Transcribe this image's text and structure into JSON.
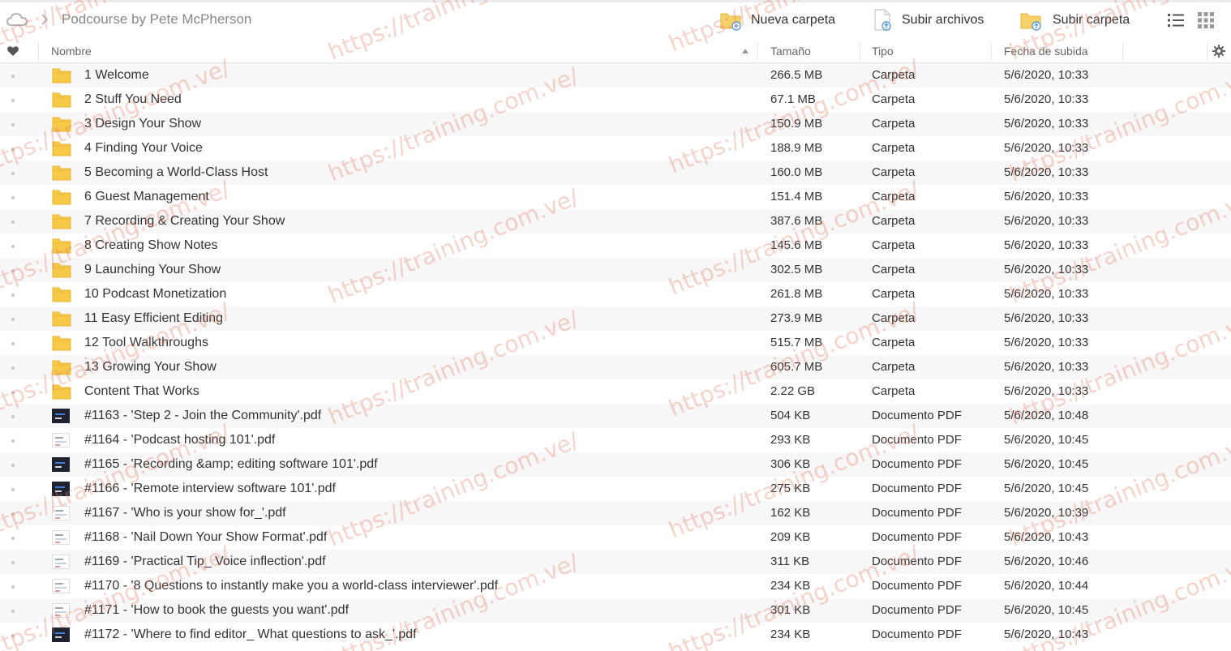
{
  "breadcrumb": {
    "title": "Podcourse by Pete McPherson"
  },
  "toolbar": {
    "new_folder": "Nueva carpeta",
    "upload_files": "Subir archivos",
    "upload_folder": "Subir carpeta"
  },
  "columns": {
    "name": "Nombre",
    "size": "Tamaño",
    "type": "Tipo",
    "date": "Fecha de subida"
  },
  "items": [
    {
      "kind": "folder",
      "name": "1 Welcome",
      "size": "266.5 MB",
      "type": "Carpeta",
      "date": "5/6/2020, 10:33"
    },
    {
      "kind": "folder",
      "name": "2 Stuff You Need",
      "size": "67.1 MB",
      "type": "Carpeta",
      "date": "5/6/2020, 10:33"
    },
    {
      "kind": "folder",
      "name": "3 Design Your Show",
      "size": "150.9 MB",
      "type": "Carpeta",
      "date": "5/6/2020, 10:33"
    },
    {
      "kind": "folder",
      "name": "4 Finding Your Voice",
      "size": "188.9 MB",
      "type": "Carpeta",
      "date": "5/6/2020, 10:33"
    },
    {
      "kind": "folder",
      "name": "5 Becoming a World-Class Host",
      "size": "160.0 MB",
      "type": "Carpeta",
      "date": "5/6/2020, 10:33"
    },
    {
      "kind": "folder",
      "name": "6 Guest Management",
      "size": "151.4 MB",
      "type": "Carpeta",
      "date": "5/6/2020, 10:33"
    },
    {
      "kind": "folder",
      "name": "7 Recording & Creating Your Show",
      "size": "387.6 MB",
      "type": "Carpeta",
      "date": "5/6/2020, 10:33"
    },
    {
      "kind": "folder",
      "name": "8 Creating Show Notes",
      "size": "145.6 MB",
      "type": "Carpeta",
      "date": "5/6/2020, 10:33"
    },
    {
      "kind": "folder",
      "name": "9 Launching Your Show",
      "size": "302.5 MB",
      "type": "Carpeta",
      "date": "5/6/2020, 10:33"
    },
    {
      "kind": "folder",
      "name": "10 Podcast Monetization",
      "size": "261.8 MB",
      "type": "Carpeta",
      "date": "5/6/2020, 10:33"
    },
    {
      "kind": "folder",
      "name": "11 Easy Efficient Editing",
      "size": "273.9 MB",
      "type": "Carpeta",
      "date": "5/6/2020, 10:33"
    },
    {
      "kind": "folder",
      "name": "12 Tool Walkthroughs",
      "size": "515.7 MB",
      "type": "Carpeta",
      "date": "5/6/2020, 10:33"
    },
    {
      "kind": "folder",
      "name": "13 Growing Your Show",
      "size": "605.7 MB",
      "type": "Carpeta",
      "date": "5/6/2020, 10:33"
    },
    {
      "kind": "folder",
      "name": "Content That Works",
      "size": "2.22 GB",
      "type": "Carpeta",
      "date": "5/6/2020, 10:33"
    },
    {
      "kind": "pdf-dark",
      "name": "#1163 - 'Step 2 - Join the Community'.pdf",
      "size": "504 KB",
      "type": "Documento PDF",
      "date": "5/6/2020, 10:48"
    },
    {
      "kind": "pdf-light",
      "name": "#1164 - 'Podcast hosting 101'.pdf",
      "size": "293 KB",
      "type": "Documento PDF",
      "date": "5/6/2020, 10:45"
    },
    {
      "kind": "pdf-dark",
      "name": "#1165 - 'Recording &amp; editing software 101'.pdf",
      "size": "306 KB",
      "type": "Documento PDF",
      "date": "5/6/2020, 10:45"
    },
    {
      "kind": "pdf-dark",
      "name": "#1166 - 'Remote interview software 101'.pdf",
      "size": "275 KB",
      "type": "Documento PDF",
      "date": "5/6/2020, 10:45"
    },
    {
      "kind": "pdf-light",
      "name": "#1167 - 'Who is your show for_'.pdf",
      "size": "162 KB",
      "type": "Documento PDF",
      "date": "5/6/2020, 10:39"
    },
    {
      "kind": "pdf-light",
      "name": "#1168 - 'Nail Down Your Show Format'.pdf",
      "size": "209 KB",
      "type": "Documento PDF",
      "date": "5/6/2020, 10:43"
    },
    {
      "kind": "pdf-light",
      "name": "#1169 - 'Practical Tip_ Voice inflection'.pdf",
      "size": "311 KB",
      "type": "Documento PDF",
      "date": "5/6/2020, 10:46"
    },
    {
      "kind": "pdf-light",
      "name": "#1170 - '8 Questions to instantly make you a world-class interviewer'.pdf",
      "size": "234 KB",
      "type": "Documento PDF",
      "date": "5/6/2020, 10:44"
    },
    {
      "kind": "pdf-light",
      "name": "#1171 - 'How to book the guests you want'.pdf",
      "size": "301 KB",
      "type": "Documento PDF",
      "date": "5/6/2020, 10:45"
    },
    {
      "kind": "pdf-dark",
      "name": "#1172 - 'Where to find editor_ What questions to ask_'.pdf",
      "size": "234 KB",
      "type": "Documento PDF",
      "date": "5/6/2020, 10:43"
    }
  ],
  "watermark": "https://training.com.ve/",
  "colors": {
    "folder": "#f7c948",
    "folder_dark": "#e8b530",
    "watermark": "#e87860",
    "row_stripe": "#f7f7f7"
  }
}
